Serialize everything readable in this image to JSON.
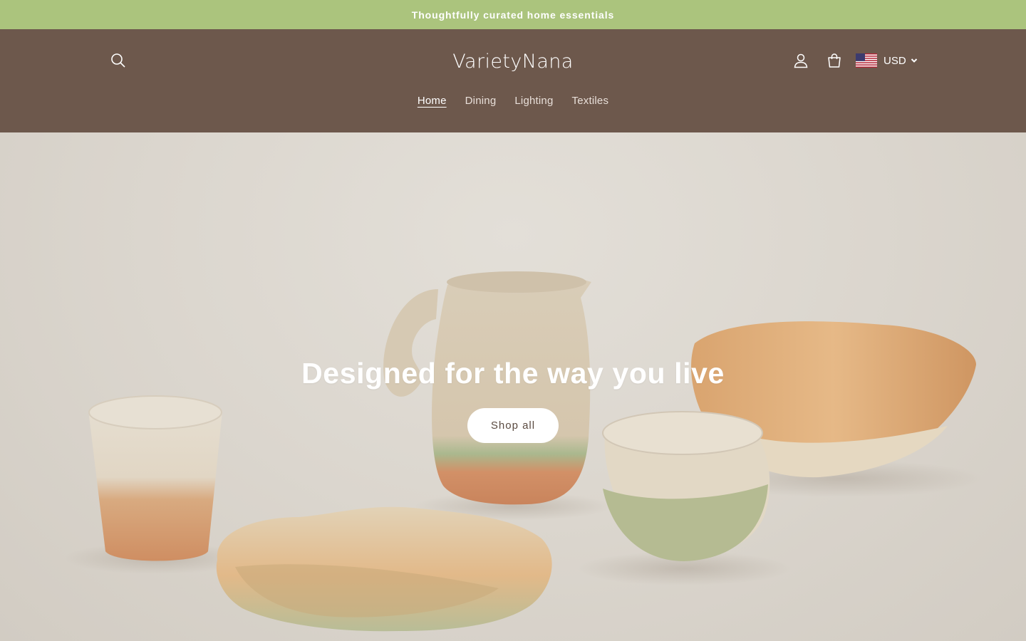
{
  "announcement": {
    "text": "Thoughtfully curated home essentials"
  },
  "header": {
    "logo": "VarietyNana",
    "currency": {
      "code": "USD",
      "flag_icon": "us-flag-icon"
    },
    "icons": {
      "search": "search-icon",
      "account": "user-icon",
      "cart": "cart-icon"
    },
    "colors": {
      "header_bg": "#6d584c",
      "announcement_bg": "#abc47d"
    }
  },
  "nav": {
    "items": [
      {
        "label": "Home",
        "active": true
      },
      {
        "label": "Dining",
        "active": false
      },
      {
        "label": "Lighting",
        "active": false
      },
      {
        "label": "Textiles",
        "active": false
      }
    ]
  },
  "hero": {
    "heading": "Designed for the way you live",
    "button_label": "Shop all"
  }
}
